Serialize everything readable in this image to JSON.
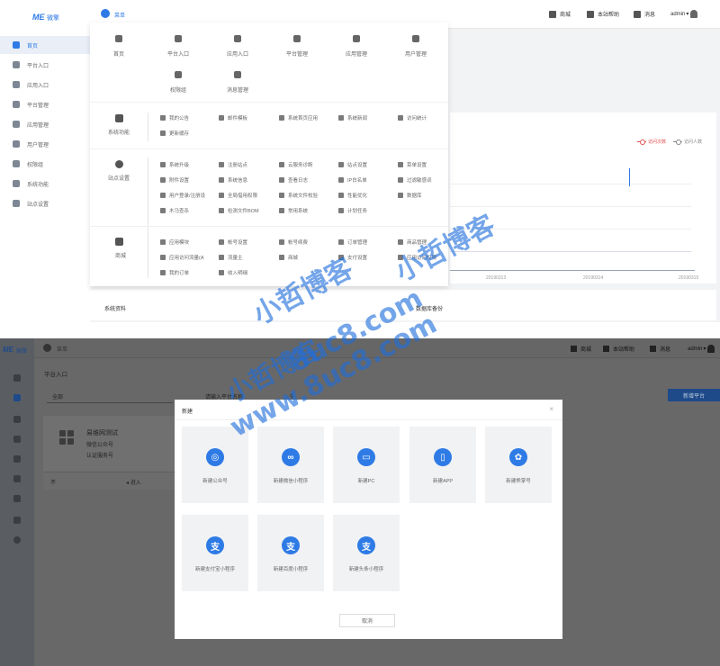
{
  "top_app": {
    "logo_mark": "ME",
    "logo_text": "微擎",
    "menu_label": "菜单",
    "sidebar": [
      {
        "label": "首页",
        "icon": "home-icon"
      },
      {
        "label": "平台入口",
        "icon": "grid-icon"
      },
      {
        "label": "应用入口",
        "icon": "cube-icon"
      },
      {
        "label": "平台管理",
        "icon": "apps-icon"
      },
      {
        "label": "应用管理",
        "icon": "app-gear-icon"
      },
      {
        "label": "用户管理",
        "icon": "user-gear-icon"
      },
      {
        "label": "权限组",
        "icon": "user-key-icon"
      },
      {
        "label": "系统功能",
        "icon": "monitor-icon"
      },
      {
        "label": "站点设置",
        "icon": "globe-icon"
      }
    ],
    "header": {
      "shop": "商城",
      "help": "本站帮助",
      "notice": "消息",
      "user": "admin"
    },
    "mega_menu": {
      "top_items": [
        "首页",
        "平台入口",
        "应用入口",
        "平台管理",
        "应用管理",
        "用户管理",
        "权限组",
        "消息管理"
      ],
      "sections": [
        {
          "label": "系统功能",
          "items": [
            "我的公告",
            "邮件模板",
            "系统首页应用",
            "系统新闻",
            "访问统计",
            "更新缓存"
          ]
        },
        {
          "label": "站点设置",
          "items": [
            "系统升级",
            "注册站点",
            "云服务诊断",
            "站点设置",
            "菜单设置",
            "附件设置",
            "系统信息",
            "查看日志",
            "IP白名单",
            "过滤敏感词",
            "用户登录/注册设",
            "全局借用权限",
            "系统文件校验",
            "性能优化",
            "数据库",
            "木马查杀",
            "检测文件BOM",
            "常用系统",
            "",
            "计划任务"
          ]
        },
        {
          "label": "商城",
          "items": [
            "应用模块",
            "帐号设置",
            "帐号续费",
            "订单管理",
            "商品管理",
            "应用访问流量(A",
            "流量主",
            "商城",
            "支付设置",
            "应用访问权限",
            "我的订单",
            "收入明细"
          ]
        }
      ]
    },
    "chart": {
      "legend": [
        "访问次数",
        "访问人数"
      ],
      "x_labels": [
        "20190313",
        "20190314",
        "20190315"
      ]
    },
    "bottom_panels": [
      "系统资料",
      "数据库备份"
    ]
  },
  "bottom_app": {
    "logo_mark": "ME",
    "logo_text": "微擎",
    "menu_label": "菜单",
    "header": {
      "shop": "商城",
      "help": "本站帮助",
      "notice": "消息",
      "user": "admin"
    },
    "breadcrumb": "平台入口",
    "filter": {
      "select": "全部",
      "search_placeholder": "请输入平台名称"
    },
    "new_platform_button": "新增平台",
    "platform_card": {
      "name": "易维网测试",
      "type": "微信公众号",
      "sub": "认证服务号",
      "foot_left": "不",
      "foot_right": "进入"
    },
    "modal": {
      "title": "新建",
      "tiles": [
        {
          "label": "新建公众号",
          "icon": "wechat-icon",
          "glyph": "◎"
        },
        {
          "label": "新建微信小程序",
          "icon": "mini-program-icon",
          "glyph": "∞"
        },
        {
          "label": "新建PC",
          "icon": "pc-icon",
          "glyph": "▭"
        },
        {
          "label": "新建APP",
          "icon": "app-phone-icon",
          "glyph": "▯"
        },
        {
          "label": "新建熊掌号",
          "icon": "paw-icon",
          "glyph": "✿"
        },
        {
          "label": "新建支付宝小程序",
          "icon": "alipay-icon",
          "glyph": "支"
        },
        {
          "label": "新建百度小程序",
          "icon": "alipay-icon",
          "glyph": "支"
        },
        {
          "label": "新建头条小程序",
          "icon": "alipay-icon",
          "glyph": "支"
        }
      ],
      "cancel": "取消"
    }
  },
  "watermark": {
    "text1": "小哲博客",
    "text2": "8uc8.com",
    "text3": "www.8uc8.com"
  }
}
